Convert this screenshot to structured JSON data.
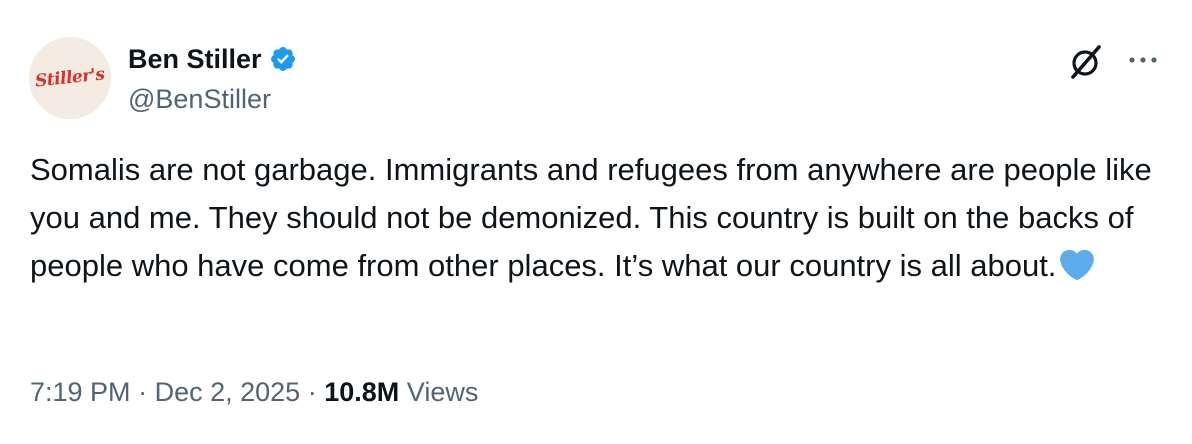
{
  "author": {
    "avatar_text": "Stiller's",
    "display_name": "Ben Stiller",
    "handle": "@BenStiller",
    "verified_icon": "verified-badge-icon",
    "verified_color": "#1d9bf0"
  },
  "actions": {
    "grok_icon": "grok-icon",
    "more_icon": "more-options-icon"
  },
  "tweet": {
    "text": "Somalis are not garbage. Immigrants and refugees from anywhere are people like you and me. They should not be demonized. This country is built on the backs of people who have come from other places. It’s what our country is all about.",
    "emoji": "blue-heart-icon",
    "emoji_color": "#5dadec"
  },
  "meta": {
    "time": "7:19 PM",
    "separator": "·",
    "date": "Dec 2, 2025",
    "views_count": "10.8M",
    "views_label": "Views"
  },
  "colors": {
    "text_primary": "#0f1419",
    "text_secondary": "#536471",
    "avatar_bg": "#f4ebe2",
    "avatar_logo": "#d8312a"
  }
}
